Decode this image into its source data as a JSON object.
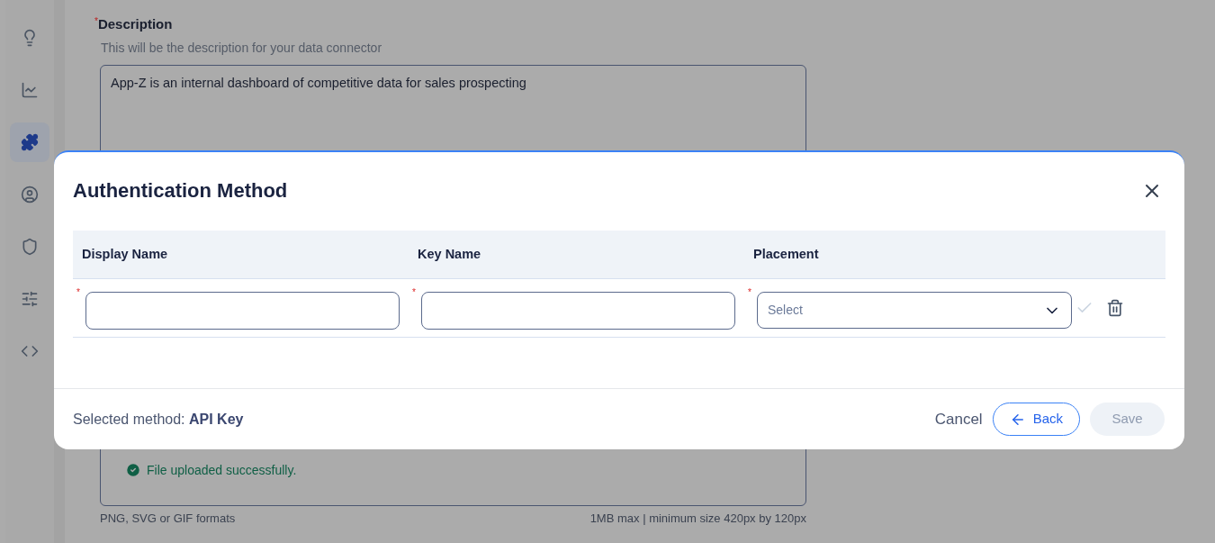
{
  "sidebar": {
    "items": [
      {
        "selected": false
      },
      {
        "selected": false
      },
      {
        "selected": true
      },
      {
        "selected": false
      },
      {
        "selected": false
      },
      {
        "selected": false
      },
      {
        "selected": false
      }
    ]
  },
  "form": {
    "description": {
      "label": "Description",
      "required_mark": "*",
      "hint": "This will be the description for your data connector",
      "value": "App-Z is an internal dashboard of competitive data for sales prospecting"
    },
    "upload": {
      "status": "File uploaded successfully.",
      "formats": "PNG, SVG or GIF formats",
      "size_note": "1MB max | minimum size 420px by 120px"
    }
  },
  "dialog": {
    "title": "Authentication Method",
    "columns": [
      "Display Name",
      "Key Name",
      "Placement"
    ],
    "row": {
      "fields": [
        {
          "kind": "text",
          "required_mark": "*"
        },
        {
          "kind": "text",
          "required_mark": "*"
        },
        {
          "kind": "select",
          "required_mark": "*",
          "placeholder": "Select"
        }
      ],
      "confirm_disabled": true
    },
    "selected_method": "Selected method: **API Key**",
    "buttons": [
      {
        "label": "Cancel",
        "kind": "text"
      },
      {
        "label": "Back",
        "kind": "back"
      },
      {
        "label": "Save",
        "kind": "primary",
        "disabled": true
      }
    ]
  }
}
